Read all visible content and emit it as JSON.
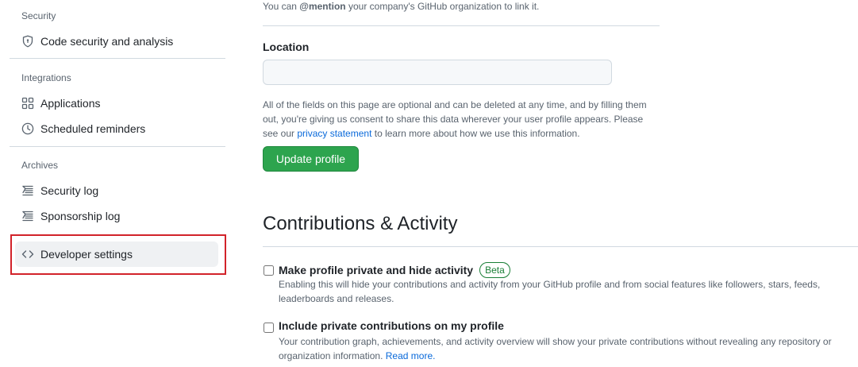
{
  "sidebar": {
    "sections": [
      {
        "heading": "Security",
        "items": [
          {
            "label": "Code security and analysis",
            "icon": "shield-icon"
          }
        ]
      },
      {
        "heading": "Integrations",
        "items": [
          {
            "label": "Applications",
            "icon": "apps-icon"
          },
          {
            "label": "Scheduled reminders",
            "icon": "clock-icon"
          }
        ]
      },
      {
        "heading": "Archives",
        "items": [
          {
            "label": "Security log",
            "icon": "log-icon"
          },
          {
            "label": "Sponsorship log",
            "icon": "log-icon"
          }
        ]
      }
    ],
    "developer_settings": {
      "label": "Developer settings",
      "icon": "code-icon"
    }
  },
  "profile": {
    "company_hint_prefix": "You can ",
    "company_hint_mention": "@mention",
    "company_hint_suffix": " your company's GitHub organization to link it.",
    "location_label": "Location",
    "location_value": "",
    "notice_text": "All of the fields on this page are optional and can be deleted at any time, and by filling them out, you're giving us consent to share this data wherever your user profile appears. Please see our ",
    "notice_link": "privacy statement",
    "notice_suffix": " to learn more about how we use this information.",
    "update_button": "Update profile"
  },
  "contributions": {
    "title": "Contributions & Activity",
    "private_profile": {
      "label": "Make profile private and hide activity",
      "badge": "Beta",
      "description": "Enabling this will hide your contributions and activity from your GitHub profile and from social features like followers, stars, feeds, leaderboards and releases.",
      "checked": false
    },
    "private_contributions": {
      "label": "Include private contributions on my profile",
      "description": "Your contribution graph, achievements, and activity overview will show your private contributions without revealing any repository or organization information. ",
      "link": "Read more.",
      "checked": false
    }
  },
  "colors": {
    "primary_button": "#2da44e",
    "link": "#0969da",
    "highlight": "#d2232a",
    "badge": "#1a7f37"
  }
}
